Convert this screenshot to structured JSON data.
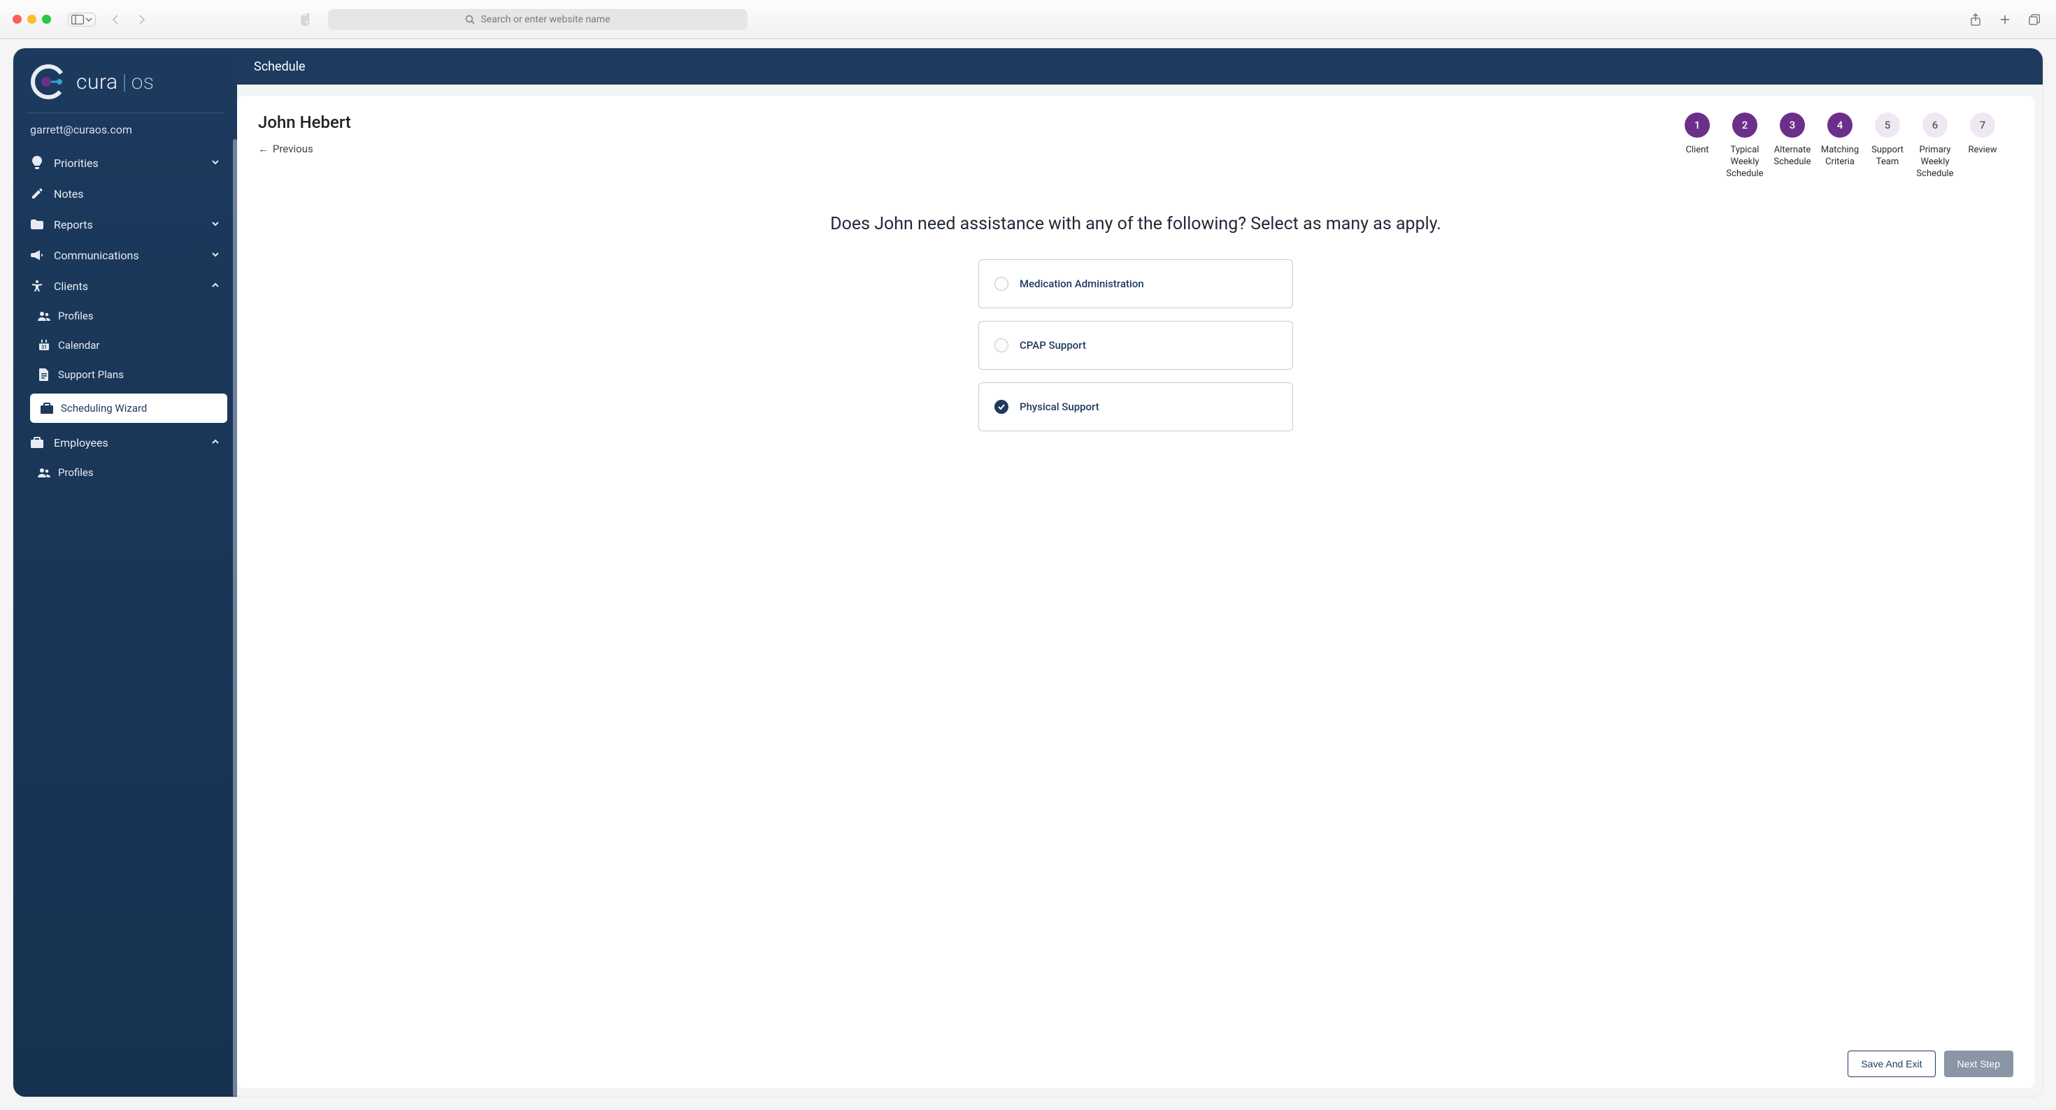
{
  "browser": {
    "url_placeholder": "Search or enter website name"
  },
  "brand": {
    "name_a": "cura",
    "name_b": "os"
  },
  "user_email": "garrett@curaos.com",
  "sidebar": {
    "items": [
      {
        "label": "Priorities",
        "icon": "lightbulb",
        "expandable": true,
        "expanded": false
      },
      {
        "label": "Notes",
        "icon": "pencil",
        "expandable": false
      },
      {
        "label": "Reports",
        "icon": "folder",
        "expandable": true,
        "expanded": false
      },
      {
        "label": "Communications",
        "icon": "megaphone",
        "expandable": true,
        "expanded": false
      },
      {
        "label": "Clients",
        "icon": "accessibility",
        "expandable": true,
        "expanded": true,
        "children": [
          {
            "label": "Profiles",
            "icon": "people"
          },
          {
            "label": "Calendar",
            "icon": "calendar"
          },
          {
            "label": "Support Plans",
            "icon": "document"
          },
          {
            "label": "Scheduling Wizard",
            "icon": "briefcase",
            "active": true
          }
        ]
      },
      {
        "label": "Employees",
        "icon": "briefcase",
        "expandable": true,
        "expanded": true,
        "children": [
          {
            "label": "Profiles",
            "icon": "people"
          }
        ]
      }
    ]
  },
  "page": {
    "topbar_title": "Schedule",
    "client_name": "John Hebert",
    "previous_label": "Previous",
    "question": "Does John need assistance with any of the following? Select as many as apply.",
    "stepper": [
      {
        "num": "1",
        "label": "Client",
        "done": true
      },
      {
        "num": "2",
        "label": "Typical Weekly Schedule",
        "done": true
      },
      {
        "num": "3",
        "label": "Alternate Schedule",
        "done": true
      },
      {
        "num": "4",
        "label": "Matching Criteria",
        "done": true
      },
      {
        "num": "5",
        "label": "Support Team",
        "done": false
      },
      {
        "num": "6",
        "label": "Primary Weekly Schedule",
        "done": false
      },
      {
        "num": "7",
        "label": "Review",
        "done": false
      }
    ],
    "options": [
      {
        "label": "Medication Administration",
        "selected": false
      },
      {
        "label": "CPAP Support",
        "selected": false
      },
      {
        "label": "Physical Support",
        "selected": true
      }
    ],
    "save_exit_label": "Save And Exit",
    "next_step_label": "Next Step"
  }
}
